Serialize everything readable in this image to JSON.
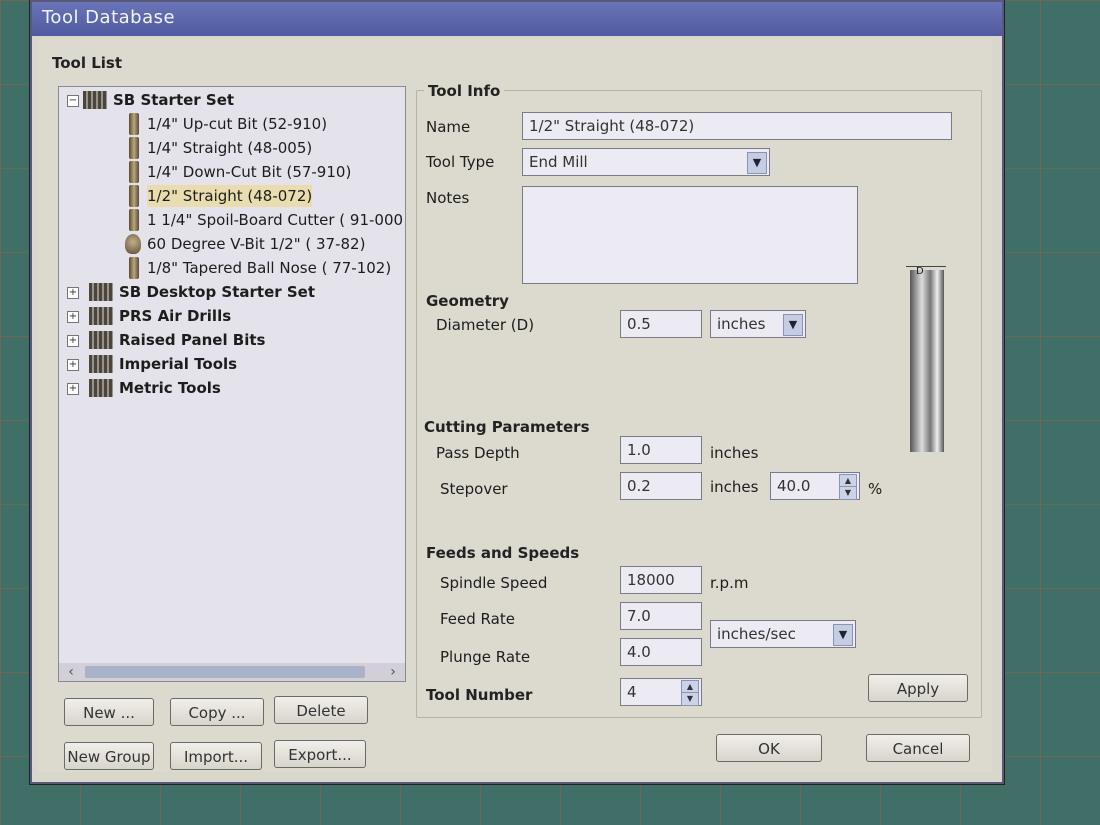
{
  "window": {
    "title": "Tool Database"
  },
  "tool_list": {
    "heading": "Tool List",
    "groups": [
      {
        "label": "SB Starter Set",
        "expanded": true,
        "items": [
          "1/4\" Up-cut Bit (52-910)",
          "1/4\" Straight (48-005)",
          "1/4\" Down-Cut Bit (57-910)",
          "1/2\" Straight (48-072)",
          "1 1/4\" Spoil-Board Cutter ( 91-000",
          "60 Degree V-Bit 1/2\" ( 37-82)",
          "1/8\" Tapered Ball Nose ( 77-102)"
        ],
        "selected_index": 3
      },
      {
        "label": "SB Desktop Starter Set",
        "expanded": false
      },
      {
        "label": "PRS Air Drills",
        "expanded": false
      },
      {
        "label": "Raised Panel Bits",
        "expanded": false
      },
      {
        "label": "Imperial Tools",
        "expanded": false
      },
      {
        "label": "Metric Tools",
        "expanded": false
      }
    ],
    "buttons": {
      "new": "New ...",
      "copy": "Copy ...",
      "delete": "Delete",
      "new_group": "New Group",
      "import": "Import...",
      "export": "Export..."
    }
  },
  "tool_info": {
    "heading": "Tool Info",
    "name_label": "Name",
    "name_value": "1/2\" Straight  (48-072)",
    "type_label": "Tool Type",
    "type_value": "End Mill",
    "notes_label": "Notes",
    "notes_value": ""
  },
  "geometry": {
    "heading": "Geometry",
    "diameter_label": "Diameter (D)",
    "diameter_value": "0.5",
    "diameter_units": "inches",
    "dim_marker": "D"
  },
  "cutting": {
    "heading": "Cutting Parameters",
    "pass_depth_label": "Pass Depth",
    "pass_depth_value": "1.0",
    "pass_depth_units": "inches",
    "stepover_label": "Stepover",
    "stepover_value": "0.2",
    "stepover_units": "inches",
    "stepover_percent": "40.0",
    "percent_sign": "%"
  },
  "feeds": {
    "heading": "Feeds and Speeds",
    "spindle_label": "Spindle Speed",
    "spindle_value": "18000",
    "spindle_units": "r.p.m",
    "feed_label": "Feed Rate",
    "feed_value": "7.0",
    "plunge_label": "Plunge Rate",
    "plunge_value": "4.0",
    "rate_units": "inches/sec"
  },
  "tool_number": {
    "label": "Tool Number",
    "value": "4"
  },
  "dialog_buttons": {
    "apply": "Apply",
    "ok": "OK",
    "cancel": "Cancel"
  }
}
